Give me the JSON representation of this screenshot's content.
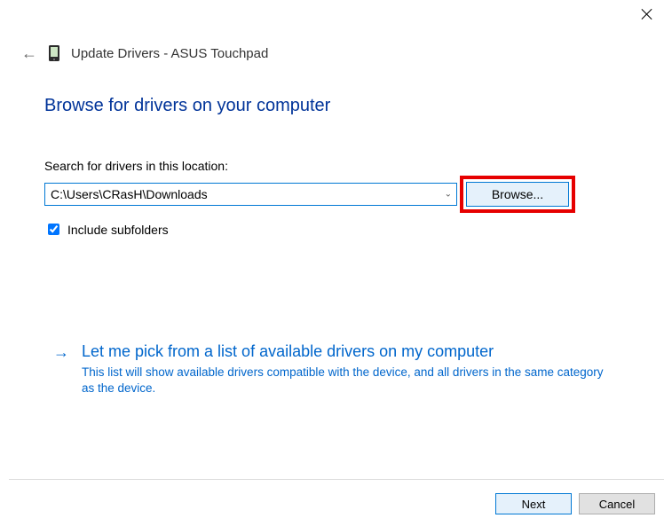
{
  "window": {
    "title": "Update Drivers - ASUS Touchpad"
  },
  "instruction": "Browse for drivers on your computer",
  "search": {
    "label": "Search for drivers in this location:",
    "path": "C:\\Users\\CRasH\\Downloads",
    "browse": "Browse..."
  },
  "include_subfolders": {
    "label": "Include subfolders",
    "checked": true
  },
  "option": {
    "title": "Let me pick from a list of available drivers on my computer",
    "description": "This list will show available drivers compatible with the device, and all drivers in the same category as the device."
  },
  "buttons": {
    "next": "Next",
    "cancel": "Cancel"
  }
}
